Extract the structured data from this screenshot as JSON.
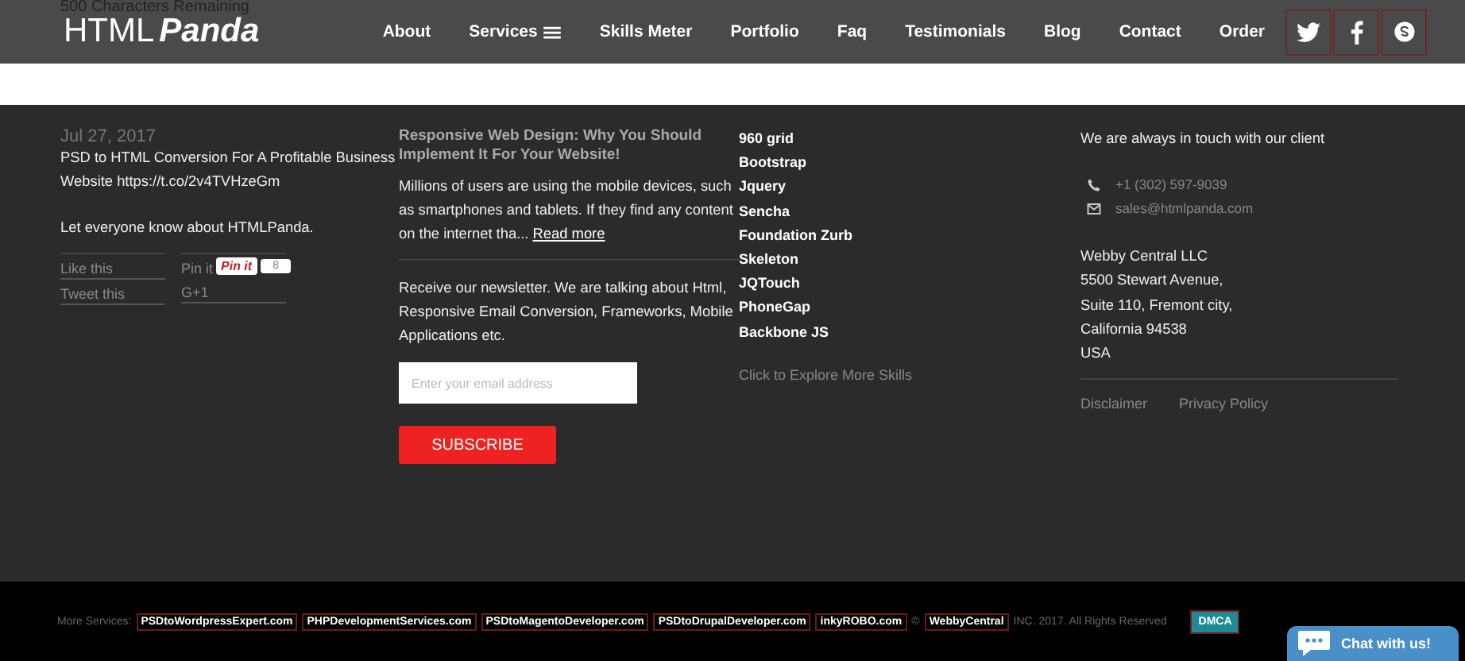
{
  "header": {
    "overlay_text": "500 Characters Remaining",
    "logo": {
      "left": "HTML",
      "right": "Panda"
    },
    "nav": [
      {
        "label": "About",
        "menu": false
      },
      {
        "label": "Services",
        "menu": true
      },
      {
        "label": "Skills Meter",
        "menu": false
      },
      {
        "label": "Portfolio",
        "menu": false
      },
      {
        "label": "Faq",
        "menu": false
      },
      {
        "label": "Testimonials",
        "menu": false
      },
      {
        "label": "Blog",
        "menu": false
      },
      {
        "label": "Contact",
        "menu": false
      },
      {
        "label": "Order",
        "menu": false
      }
    ],
    "social": [
      {
        "kind": "twitter"
      },
      {
        "kind": "facebook"
      },
      {
        "kind": "skype"
      }
    ]
  },
  "tweet": {
    "date": "Jul 27, 2017",
    "text": "PSD to HTML Conversion For A Profitable Business Website https://t.co/2v4TVHzeGm",
    "share_prompt": "Let everyone know about HTMLPanda.",
    "share_left": [
      "Like this",
      "Tweet this"
    ],
    "share_right": [
      "Pin it",
      "G+1"
    ],
    "pin_button": "Pin it",
    "pin_count": "8"
  },
  "blog": {
    "title": "Responsive Web Design: Why You Should Implement It For Your Website!",
    "excerpt": "Millions of users are using the mobile devices, such as smartphones and tablets. If they find any content on the internet tha...",
    "read_more": "Read more",
    "newsletter": "Receive our newsletter. We are talking about Html, Responsive Email Conversion, Frameworks, Mobile Applications etc.",
    "email_placeholder": "Enter your email address",
    "subscribe": "SUBSCRIBE"
  },
  "skills": {
    "items": [
      "960 grid",
      "Bootstrap",
      "Jquery",
      "Sencha",
      "Foundation Zurb",
      "Skeleton",
      "JQTouch",
      "PhoneGap",
      "Backbone JS"
    ],
    "explore": "Click to Explore More Skills"
  },
  "contact": {
    "intro": "We are always in touch with our client",
    "phone": "+1 (302) 597-9039",
    "email": "sales@htmlpanda.com",
    "address": [
      "Webby Central LLC",
      "5500 Stewart Avenue,",
      "Suite 110, Fremont city,",
      "California 94538",
      "USA"
    ],
    "links": [
      "Disclaimer",
      "Privacy Policy"
    ]
  },
  "bottom": {
    "label": "More Services:",
    "sites": [
      "PSDtoWordpressExpert.com",
      "PHPDevelopmentServices.com",
      "PSDtoMagentoDeveloper.com",
      "PSDtoDrupalDeveloper.com",
      "inkyROBO.com"
    ],
    "copy_mark": "©",
    "company": "WebbyCentral",
    "rights": "INC. 2017. All Rights Reserved",
    "dmca": "DMCA",
    "chat": "Chat with us!"
  }
}
